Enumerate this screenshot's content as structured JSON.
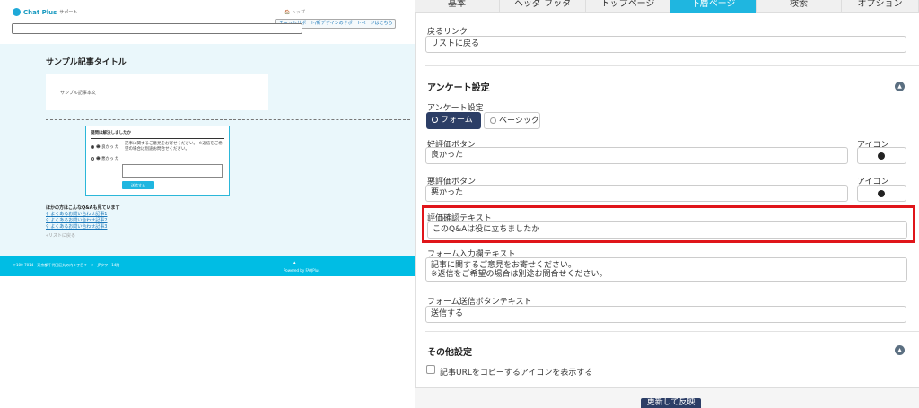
{
  "preview": {
    "logo_text": "Chat Plus",
    "logo_sub": "サポート",
    "breadcrumb": "🏠 トップ",
    "support_link": "チャットサポート/新デザインのサポートページはこちら",
    "article_title": "サンプル記事タイトル",
    "article_body": "サンプル記事本文",
    "survey": {
      "question": "疑問は解決しましたか",
      "option_good": "☻ 良かっ た",
      "option_bad": "☻ 悪かっ た",
      "form_text": "記事に関するご意見をお寄せください。 ※返信をご希望の場合は別途お問合せください。",
      "submit": "送信する"
    },
    "faq_heading": "ほかの方はこんなQ&Aも見ています",
    "faq_links": [
      "よくあるお問い合わせ記事1",
      "よくあるお問い合わせ記事2",
      "よくあるお問い合わせ記事3"
    ],
    "back_link": "«リストに戻る",
    "footer_address": "〒100-7014　東京都千代田区丸の内２丁目７−２　JPタワー14階",
    "powered_by": "Powered by FAQPlus"
  },
  "tabs": [
    "基本",
    "ヘッダ フッタ",
    "トップページ",
    "下層ページ",
    "検索",
    "オプション"
  ],
  "active_tab": "下層ページ",
  "settings": {
    "back_link_label": "戻るリンク",
    "back_link_value": "リストに戻る",
    "survey_section_title": "アンケート設定",
    "survey_type_label": "アンケート設定",
    "survey_type_options": [
      "フォーム",
      "ベーシック"
    ],
    "survey_type_selected": "フォーム",
    "good_button_label": "好評価ボタン",
    "good_button_value": "良かった",
    "bad_button_label": "悪評価ボタン",
    "bad_button_value": "悪かった",
    "icon_label": "アイコン",
    "confirm_text_label": "評価確認テキスト",
    "confirm_text_value": "このQ&Aは役に立ちましたか",
    "form_text_label": "フォーム入力欄テキスト",
    "form_text_value_line1": "記事に関するご意見をお寄せください。",
    "form_text_value_line2": "※返信をご希望の場合は別途お問合せください。",
    "form_submit_label": "フォーム送信ボタンテキスト",
    "form_submit_value": "送信する",
    "other_section_title": "その他設定",
    "copy_url_label": "記事URLをコピーするアイコンを表示する",
    "update_button": "更新して反映"
  },
  "colors": {
    "accent": "#1fb6e0",
    "footer": "#00bde4",
    "highlight": "#e0151a",
    "primary_button": "#2c3e66"
  }
}
